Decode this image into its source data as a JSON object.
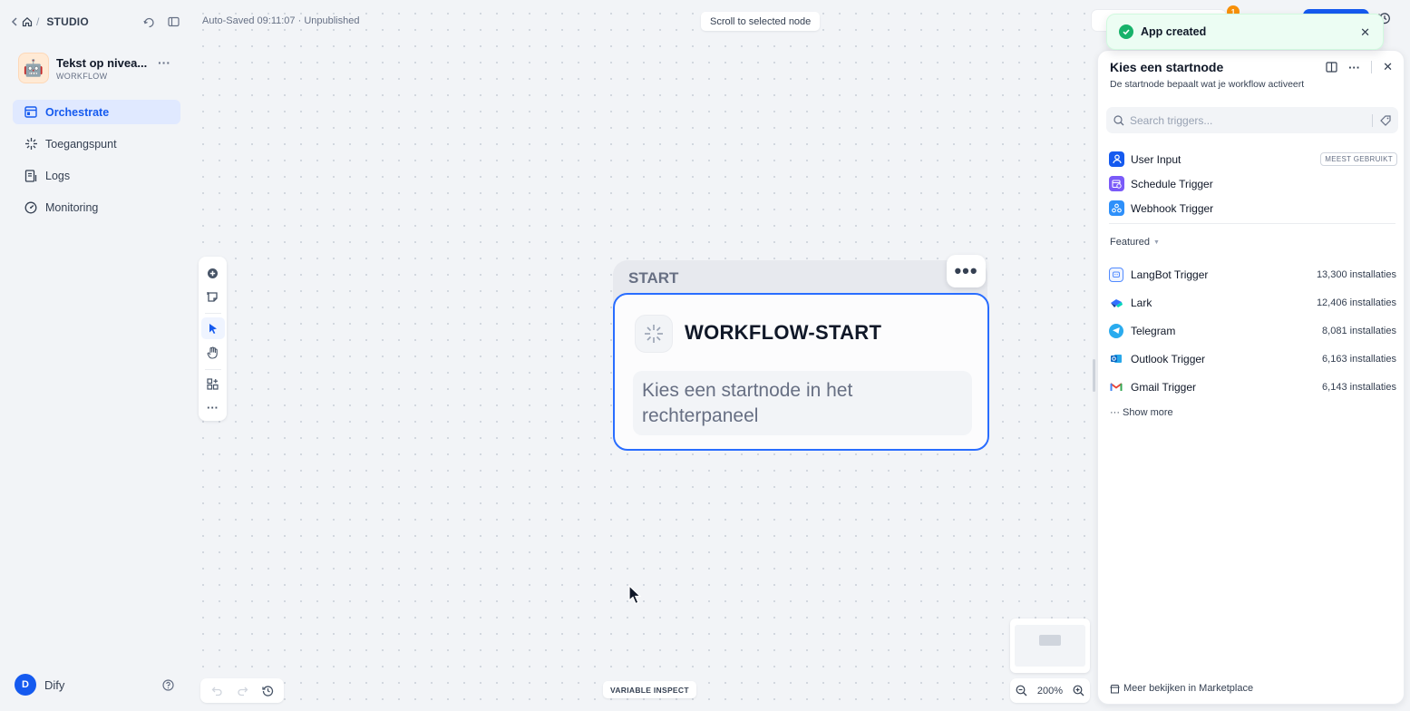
{
  "sidebar": {
    "breadcrumb": "STUDIO",
    "app": {
      "name": "Tekst op nivea...",
      "type": "WORKFLOW",
      "avatar": "🤖"
    },
    "nav": [
      {
        "label": "Orchestrate",
        "icon": "layout-icon",
        "active": true
      },
      {
        "label": "Toegangspunt",
        "icon": "sparkle-icon",
        "active": false
      },
      {
        "label": "Logs",
        "icon": "logs-icon",
        "active": false
      },
      {
        "label": "Monitoring",
        "icon": "gauge-icon",
        "active": false
      }
    ],
    "user": {
      "initial": "D",
      "name": "Dify"
    }
  },
  "canvas": {
    "autosave_status": "Auto-Saved 09:11:07 · Unpublished",
    "scroll_hint": "Scroll to selected node",
    "start_node": {
      "header": "START",
      "title": "WORKFLOW-START",
      "description": "Kies een startnode in het rechterpaneel"
    },
    "variable_inspect": "VARIABLE INSPECT",
    "zoom": "200%"
  },
  "header": {
    "notification_count": "1"
  },
  "toast": {
    "message": "App created",
    "status_color": "#17b26a"
  },
  "panel": {
    "title": "Kies een startnode",
    "subtitle": "De startnode bepaalt wat je workflow activeert",
    "search_placeholder": "Search triggers...",
    "triggers": [
      {
        "label": "User Input",
        "tag": "MEEST GEBRUIKT",
        "color": "#155aef"
      },
      {
        "label": "Schedule Trigger",
        "tag": "",
        "color": "#7a5af8"
      },
      {
        "label": "Webhook Trigger",
        "tag": "",
        "color": "#2e90fa"
      }
    ],
    "featured_label": "Featured",
    "plugins": [
      {
        "name": "LangBot Trigger",
        "installs": "13,300 installaties",
        "color": "#528bff"
      },
      {
        "name": "Lark",
        "installs": "12,406 installaties",
        "color": "#00b8d9"
      },
      {
        "name": "Telegram",
        "installs": "8,081 installaties",
        "color": "#2aabee"
      },
      {
        "name": "Outlook Trigger",
        "installs": "6,163 installaties",
        "color": "#0a66c2"
      },
      {
        "name": "Gmail Trigger",
        "installs": "6,143 installaties",
        "color": "#ea4335"
      }
    ],
    "show_more": "··· Show more",
    "marketplace_link": "Meer bekijken in Marketplace"
  },
  "colors": {
    "accent": "#155aef",
    "node_border": "#296dff",
    "canvas_bg": "#f2f4f7"
  }
}
